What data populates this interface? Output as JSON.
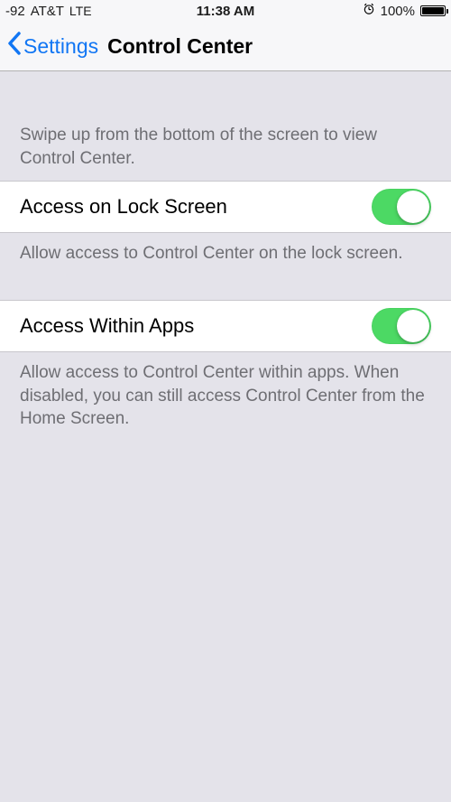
{
  "status": {
    "signal": "-92",
    "carrier": "AT&T",
    "network": "LTE",
    "time": "11:38 AM",
    "battery_pct": "100%"
  },
  "nav": {
    "back_label": "Settings",
    "title": "Control Center"
  },
  "section_intro": "Swipe up from the bottom of the screen to view Control Center.",
  "rows": {
    "lock": {
      "label": "Access on Lock Screen",
      "footer": "Allow access to Control Center on the lock screen.",
      "on": true
    },
    "apps": {
      "label": "Access Within Apps",
      "footer": "Allow access to Control Center within apps. When disabled, you can still access Control Center from the Home Screen.",
      "on": true
    }
  }
}
